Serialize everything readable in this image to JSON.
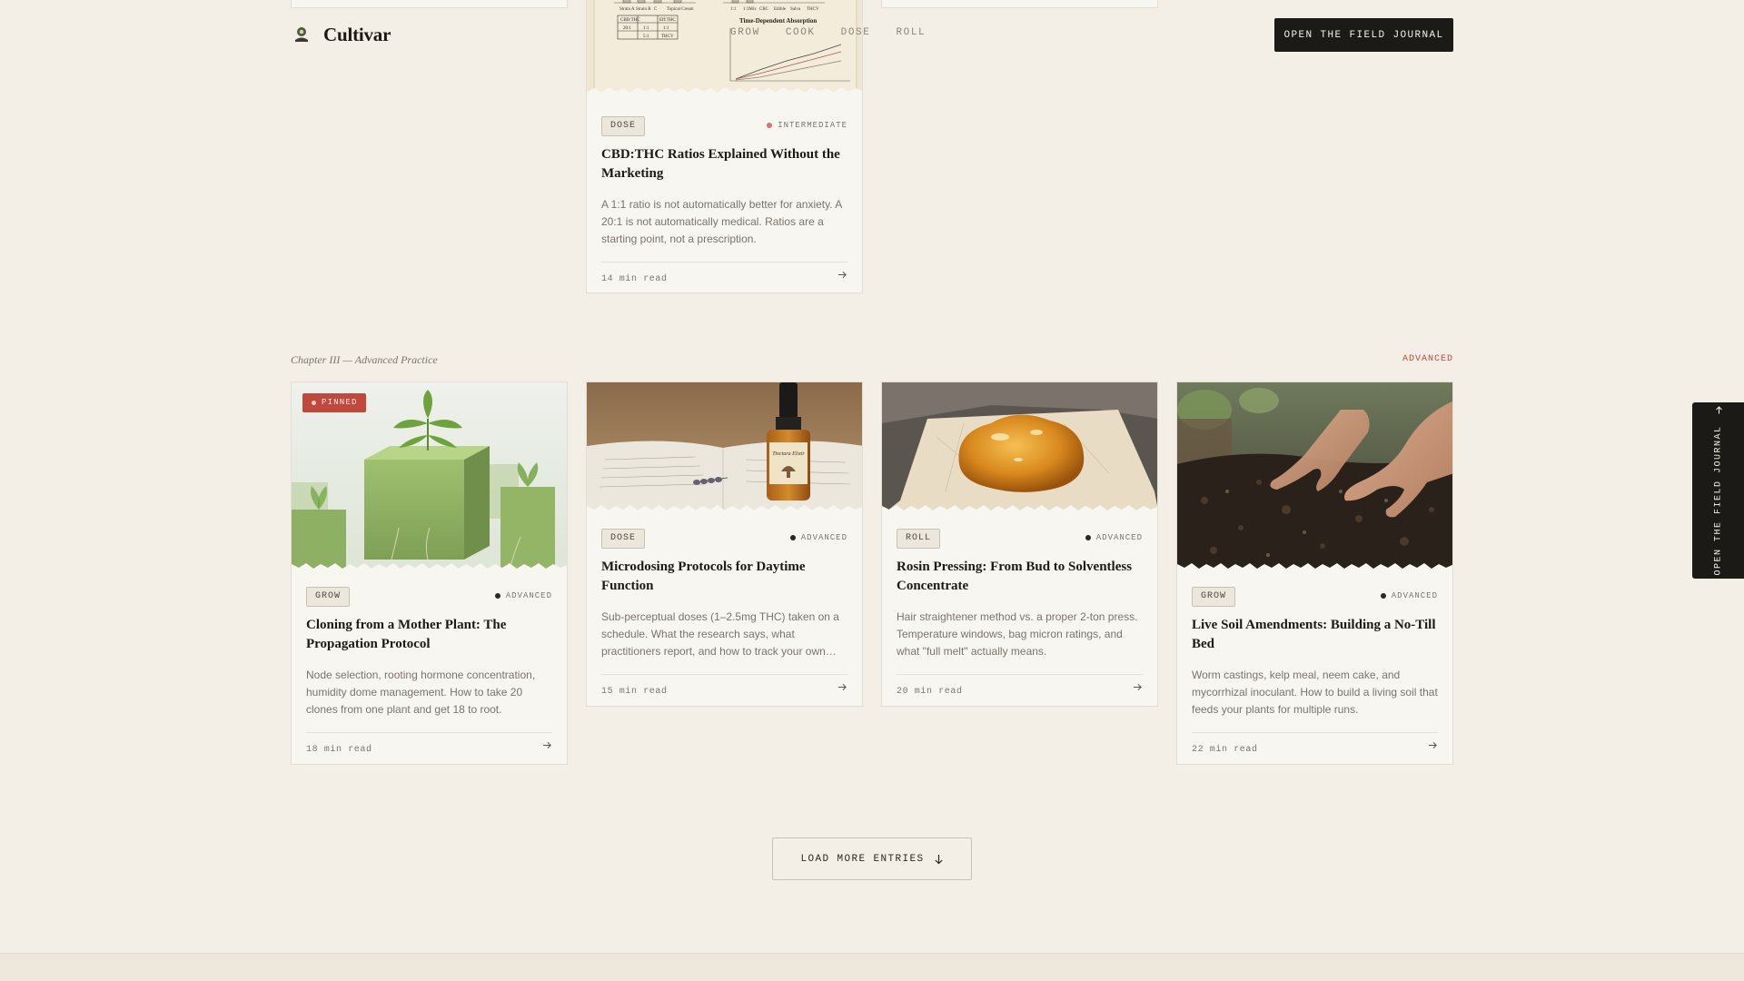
{
  "brand": {
    "name": "Cultivar"
  },
  "nav": {
    "items": [
      {
        "label": "GROW"
      },
      {
        "label": "COOK"
      },
      {
        "label": "DOSE"
      },
      {
        "label": "ROLL"
      }
    ],
    "cta_label": "OPEN THE FIELD JOURNAL"
  },
  "top_card": {
    "category": "DOSE",
    "level": "INTERMEDIATE",
    "title": "CBD:THC Ratios Explained Without the Marketing",
    "description": "A 1:1 ratio is not automatically better for anxiety. A 20:1 is not automatically medical. Ratios are a starting point, not a prescription.",
    "read_time": "14 min read",
    "image_text": {
      "chart_title": "Time-Dependent Absorption",
      "table_header_a": "CBD:THC",
      "table_header_b": "Eff:THC",
      "table_row1_a": "20:1",
      "table_row1_b": "1:1",
      "table_row1_c": "1:1",
      "table_row2_b": "5:1",
      "table_row2_c": "THCV",
      "bar_labels_left": [
        "Strain A",
        "Strain B",
        "C",
        "Topical Cream"
      ],
      "bar_labels_right": [
        "1:1",
        "1:1Mix",
        "CBC",
        "Edible",
        "Salva",
        "THCV"
      ]
    }
  },
  "chapter": {
    "label": "Chapter III — Advanced Practice",
    "tag": "ADVANCED"
  },
  "cards": [
    {
      "pinned": "PINNED",
      "category": "GROW",
      "level": "ADVANCED",
      "title": "Cloning from a Mother Plant: The Propagation Protocol",
      "description": "Node selection, rooting hormone concentration, humidity dome management. How to take 20 clones from one plant and get 18 to root.",
      "read_time": "18 min read"
    },
    {
      "category": "DOSE",
      "level": "ADVANCED",
      "title": "Microdosing Protocols for Daytime Function",
      "description": "Sub-perceptual doses (1–2.5mg THC) taken on a schedule. What the research says, what practitioners report, and how to track your own response.",
      "read_time": "15 min read",
      "image_text": {
        "bottle_label": "Tinctura Elixir"
      }
    },
    {
      "category": "ROLL",
      "level": "ADVANCED",
      "title": "Rosin Pressing: From Bud to Solventless Concentrate",
      "description": "Hair straightener method vs. a proper 2-ton press. Temperature windows, bag micron ratings, and what \"full melt\" actually means.",
      "read_time": "20 min read"
    },
    {
      "category": "GROW",
      "level": "ADVANCED",
      "title": "Live Soil Amendments: Building a No-Till Bed",
      "description": "Worm castings, kelp meal, neem cake, and mycorrhizal inoculant. How to build a living soil that feeds your plants for multiple runs.",
      "read_time": "22 min read"
    }
  ],
  "load_more": {
    "label": "LOAD MORE ENTRIES"
  },
  "side_tab": {
    "label": "OPEN THE FIELD JOURNAL"
  },
  "colors": {
    "background": "#f3efe7",
    "accent_red": "#c0483d",
    "dark": "#1c1a17"
  }
}
